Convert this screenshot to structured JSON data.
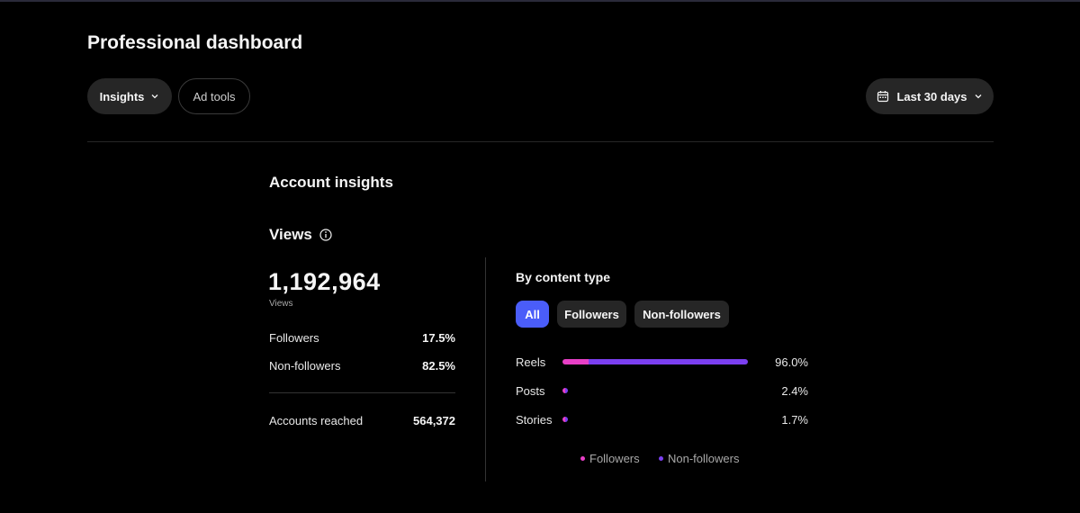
{
  "page_title": "Professional dashboard",
  "toolbar": {
    "insights_label": "Insights",
    "ad_tools_label": "Ad tools",
    "date_range_label": "Last 30 days"
  },
  "section_title": "Account insights",
  "views": {
    "title": "Views",
    "total": "1,192,964",
    "total_caption": "Views",
    "followers_label": "Followers",
    "followers_pct": "17.5%",
    "non_followers_label": "Non-followers",
    "non_followers_pct": "82.5%",
    "accounts_reached_label": "Accounts reached",
    "accounts_reached_value": "564,372"
  },
  "content_type": {
    "title": "By content type",
    "tabs": [
      {
        "label": "All",
        "active": true
      },
      {
        "label": "Followers",
        "active": false
      },
      {
        "label": "Non-followers",
        "active": false
      }
    ],
    "rows": [
      {
        "label": "Reels",
        "pct": "96.0%",
        "share": 0.96,
        "followers_fraction": 0.14
      },
      {
        "label": "Posts",
        "pct": "2.4%",
        "share": 0.024,
        "followers_fraction": 0.5
      },
      {
        "label": "Stories",
        "pct": "1.7%",
        "share": 0.017,
        "followers_fraction": 0.5
      }
    ],
    "legend": {
      "followers": "Followers",
      "non_followers": "Non-followers"
    },
    "colors": {
      "followers": "#e83fc6",
      "non_followers": "#7b3ff0",
      "active_tab": "#4a5df9"
    }
  }
}
